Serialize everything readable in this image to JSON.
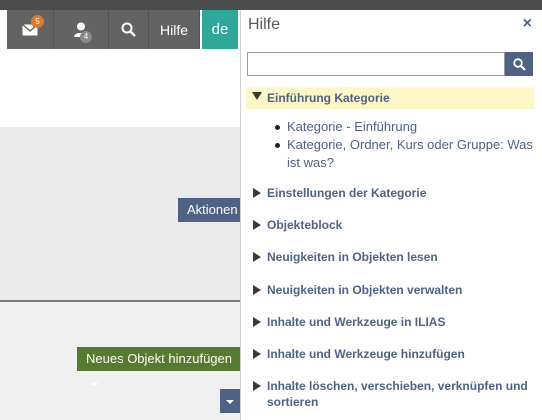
{
  "header": {
    "mail_badge": "5",
    "user_badge": "4",
    "help_label": "Hilfe",
    "lang_label": "de",
    "icons": {
      "mail": "mail-icon",
      "user": "user-icon",
      "search": "search-icon"
    }
  },
  "page": {
    "actions_label": "Aktionen",
    "new_object_label": "Neues Objekt hinzufügen"
  },
  "help": {
    "title": "Hilfe",
    "close_glyph": "×",
    "search_value": "",
    "topics": [
      {
        "label": "Einführung Kategorie",
        "expanded": true,
        "children": [
          "Kategorie - Einführung",
          "Kategorie, Ordner, Kurs oder Gruppe: Was ist was?"
        ]
      },
      {
        "label": "Einstellungen der Kategorie"
      },
      {
        "label": "Objekteblock"
      },
      {
        "label": "Neuigkeiten in Objekten lesen"
      },
      {
        "label": "Neuigkeiten in Objekten verwalten"
      },
      {
        "label": "Inhalte und Werkzeuge in ILIAS"
      },
      {
        "label": "Inhalte und Werkzeuge hinzufügen"
      },
      {
        "label": "Inhalte löschen, verschieben, verknüpfen und sortieren"
      }
    ]
  },
  "colors": {
    "accent": "#4d6285",
    "lang_accent": "#2da89a",
    "add_button": "#557b2e",
    "highlight": "#fdf6c5"
  }
}
